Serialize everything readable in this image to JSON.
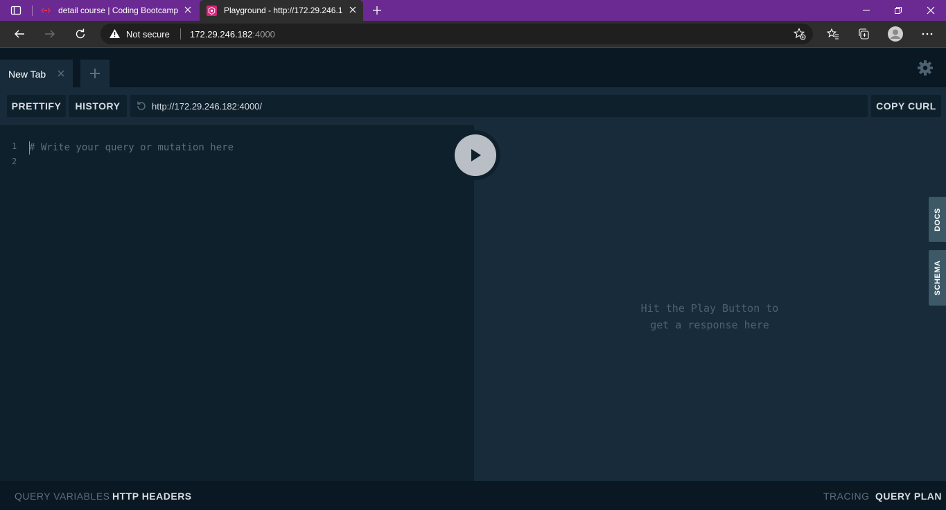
{
  "browser": {
    "tabs": [
      {
        "title": "detail course | Coding Bootcamp",
        "active": false,
        "favicon": "brand-logo-icon"
      },
      {
        "title": "Playground - http://172.29.246.1",
        "active": true,
        "favicon": "graphql-playground-icon"
      }
    ],
    "address": {
      "security_label": "Not secure",
      "host": "172.29.246.182",
      "port": ":4000"
    },
    "accent_color": "#6b2a92"
  },
  "playground": {
    "tabs": [
      {
        "label": "New Tab"
      }
    ],
    "toolbar": {
      "prettify_label": "PRETTIFY",
      "history_label": "HISTORY",
      "endpoint_url": "http://172.29.246.182:4000/",
      "copy_curl_label": "COPY CURL"
    },
    "editor": {
      "line_numbers": [
        "1",
        "2"
      ],
      "placeholder": "# Write your query or mutation here"
    },
    "result": {
      "hint": "Hit the Play Button to\nget a response here"
    },
    "side_tabs": {
      "docs": "DOCS",
      "schema": "SCHEMA"
    },
    "bottom": {
      "query_variables": "QUERY VARIABLES",
      "http_headers": "HTTP HEADERS",
      "tracing": "TRACING",
      "query_plan": "QUERY PLAN"
    },
    "colors": {
      "editor_bg": "#0f202d",
      "result_bg": "#172b3a",
      "header_bg": "#0a1823"
    }
  }
}
